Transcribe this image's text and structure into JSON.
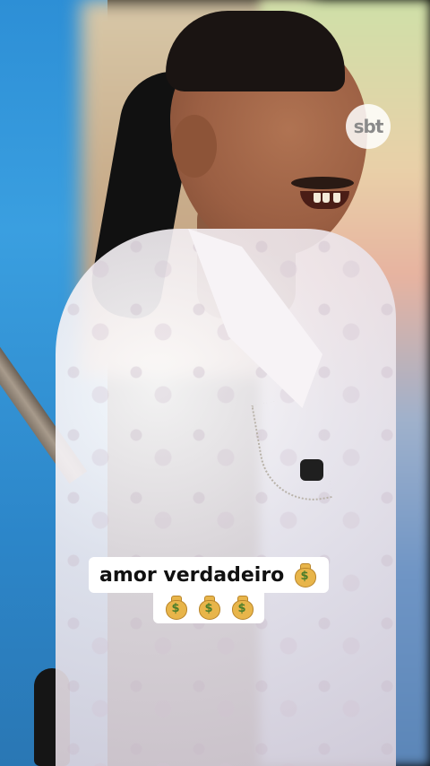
{
  "caption": {
    "line1_text": "amor verdadeiro",
    "line1_emoji": "money-bag",
    "line2_emoji": [
      "money-bag",
      "money-bag",
      "money-bag"
    ]
  },
  "watermark": {
    "logo_text": "sbt"
  },
  "colors": {
    "caption_background": "#ffffff",
    "caption_text": "#111111",
    "money_bag": "#e8b54a"
  }
}
